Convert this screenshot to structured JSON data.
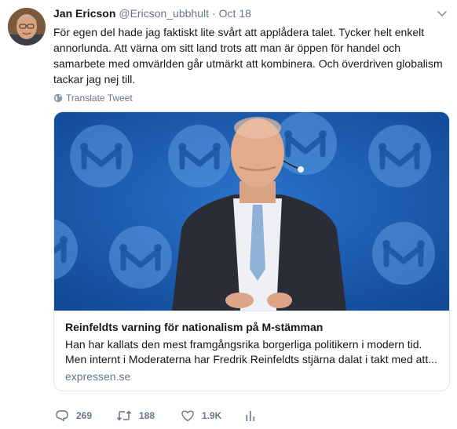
{
  "author": {
    "name": "Jan Ericson",
    "handle": "@Ericson_ubbhult",
    "separator": "·",
    "date": "Oct 18"
  },
  "tweet": {
    "text": "För egen del hade jag faktiskt lite svårt att applådera talet. Tycker helt enkelt annorlunda. Att värna om sitt land trots att man är öppen för handel och samarbete med omvärlden går utmärkt att kombinera. Och överdriven globalism tackar jag nej till.",
    "translate_label": "Translate Tweet"
  },
  "card": {
    "title": "Reinfeldts varning för nationalism på M-stämman",
    "description_lines": [
      "Han har kallats den mest framgångsrika borgerliga politikern i modern tid.",
      "Men internt i Moderaterna har Fredrik Reinfeldts stjärna dalat i takt med att..."
    ],
    "domain": "expressen.se"
  },
  "actions": {
    "replies": "269",
    "retweets": "188",
    "likes": "1.9K"
  },
  "icons": [
    "chevron-down-icon",
    "globe-icon",
    "reply-icon",
    "retweet-icon",
    "like-icon",
    "analytics-icon"
  ],
  "colors": {
    "text": "#14171a",
    "secondary": "#657786",
    "border": "#e1e8ed",
    "media_background": "#1a5bb0"
  }
}
